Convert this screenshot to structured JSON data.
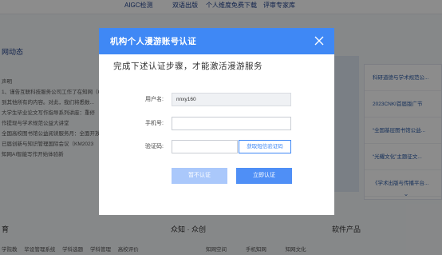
{
  "background": {
    "top_links": [
      "AIGC检测",
      "双语出版",
      "个人维度免费下载",
      "评审专家库"
    ],
    "news": {
      "title": "网动态",
      "items": [
        "声明",
        "1、谨告互联科技服务公司工作了在知网（CN",
        "到其他所有的内容。对此，我们将悉数...",
        "大学生毕业论文写作指导系列讲座：重修",
        "作提现与学术规范公益大讲堂",
        "全国高校图书馆公益阅读服务月：全面开放",
        "已届创新与知识管理国际会议（KM2023",
        "知网AI智能写作开始体验新"
      ]
    },
    "side_items": [
      "科研道德与学术规范公...",
      "2023CNKI首届版广节",
      "“全国基层图书馆公益...",
      "“光耀文化”主题征文...",
      "《学术出版与传播平台..."
    ],
    "education": {
      "title": "育",
      "links": [
        "学院教",
        "毕设管理系统",
        "学科选题",
        "学科管理",
        "高校评价"
      ]
    },
    "zhiheng": {
      "title": "众知 · 众创",
      "links": [
        "知网空间",
        "手机知网",
        "知网文化"
      ]
    },
    "software": {
      "title": "软件产品"
    }
  },
  "modal": {
    "title": "机构个人漫游账号认证",
    "description": "完成下述认证步骤，才能激活漫游服务",
    "fields": {
      "username": {
        "label": "用户名:",
        "value": "nnxy160"
      },
      "phone": {
        "label": "手机号:",
        "value": "",
        "placeholder": ""
      },
      "code": {
        "label": "验证码:",
        "value": "",
        "placeholder": ""
      }
    },
    "get_code_label": "获取短信验证码",
    "skip_label": "暂不认证",
    "auth_label": "立即认证"
  },
  "colors": {
    "accent": "#3f88f5",
    "button_disabled": "#aac8fb",
    "overlay": "rgba(0,0,0,0.45)"
  }
}
